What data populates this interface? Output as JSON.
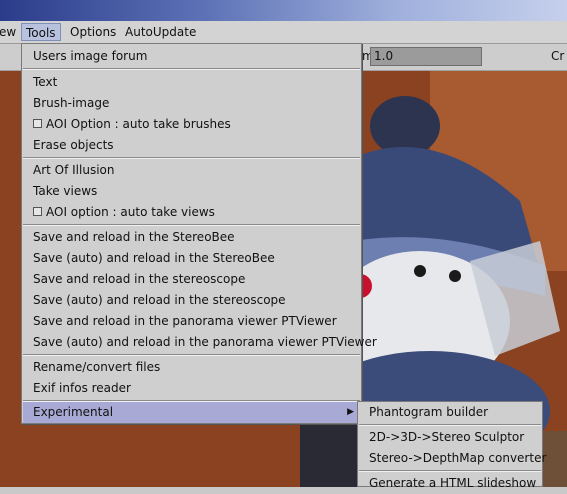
{
  "menubar": [
    "ew",
    "Tools",
    "Options",
    "AutoUpdate"
  ],
  "toolbar": {
    "zoom_label": "m",
    "zoom_value": "1.0",
    "cr_label": "Cr"
  },
  "menu": {
    "forum": "Users image forum",
    "text": "Text",
    "brush_image": "Brush-image",
    "aoi_take_brushes": "AOI Option : auto take brushes",
    "erase_objects": "Erase objects",
    "art_of_illusion": "Art Of Illusion",
    "take_views": "Take views",
    "aoi_take_views": "AOI option : auto take views",
    "stereobee_reload": "Save and reload in the StereoBee",
    "stereobee_auto": "Save (auto) and reload in the StereoBee",
    "stereoscope_reload": "Save and reload in the stereoscope",
    "stereoscope_auto": "Save (auto) and reload in the stereoscope",
    "ptviewer_reload": "Save and reload in the panorama viewer PTViewer",
    "ptviewer_auto": "Save (auto) and reload in the panorama viewer PTViewer",
    "rename_convert": "Rename/convert files",
    "exif_reader": "Exif infos reader",
    "experimental": "Experimental"
  },
  "submenu": {
    "phantogram": "Phantogram builder",
    "stereo_sculptor": "2D->3D->Stereo Sculptor",
    "depthmap": "Stereo->DepthMap converter",
    "html_slideshow": "Generate a HTML slideshow"
  },
  "colors": {
    "menu_bg": "#cfcfcf",
    "highlight": "#a9a9d6",
    "titlebar": "#2b3c8a"
  }
}
